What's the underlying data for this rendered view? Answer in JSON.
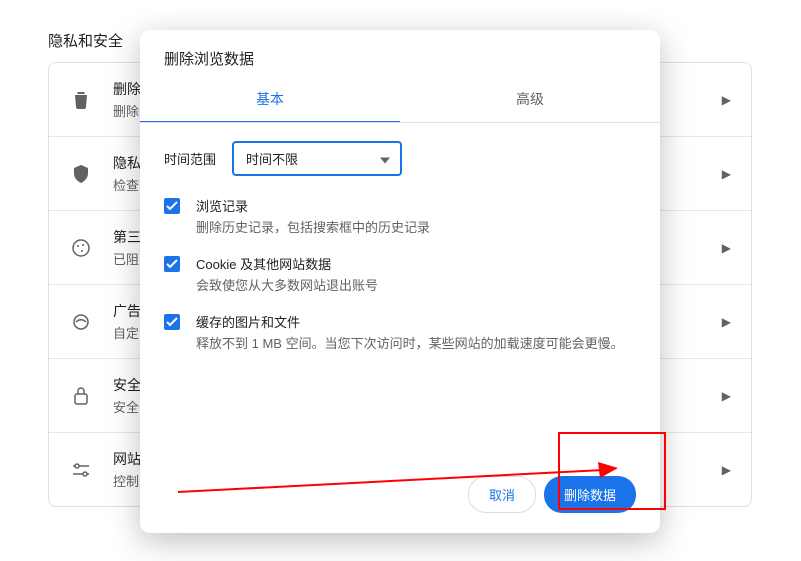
{
  "page": {
    "section_title": "隐私和安全"
  },
  "rows": [
    {
      "title": "删除",
      "sub": "删除"
    },
    {
      "title": "隐私",
      "sub": "检查"
    },
    {
      "title": "第三",
      "sub": "已阻"
    },
    {
      "title": "广告",
      "sub": "自定"
    },
    {
      "title": "安全",
      "sub": "安全"
    },
    {
      "title": "网站",
      "sub": "控制"
    }
  ],
  "dialog": {
    "title": "删除浏览数据",
    "tabs": {
      "basic": "基本",
      "advanced": "高级"
    },
    "range_label": "时间范围",
    "range_value": "时间不限",
    "items": [
      {
        "title": "浏览记录",
        "sub": "删除历史记录，包括搜索框中的历史记录",
        "checked": true
      },
      {
        "title": "Cookie 及其他网站数据",
        "sub": "会致使您从大多数网站退出账号",
        "checked": true
      },
      {
        "title": "缓存的图片和文件",
        "sub": "释放不到 1 MB 空间。当您下次访问时，某些网站的加载速度可能会更慢。",
        "checked": true
      }
    ],
    "cancel": "取消",
    "confirm": "删除数据"
  }
}
